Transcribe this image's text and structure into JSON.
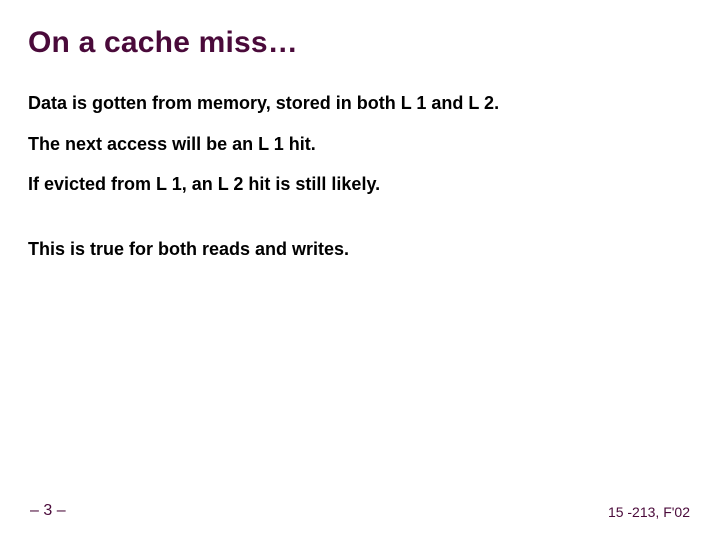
{
  "title": "On a cache miss…",
  "lines": {
    "l1": "Data is gotten from memory, stored in both L 1 and L 2.",
    "l2": "The next access will be an L 1 hit.",
    "l3": "If evicted from L 1, an L 2 hit is still likely.",
    "l4": "This is true for both reads and writes."
  },
  "footer": {
    "page": "– 3 –",
    "course": "15 -213, F'02"
  }
}
